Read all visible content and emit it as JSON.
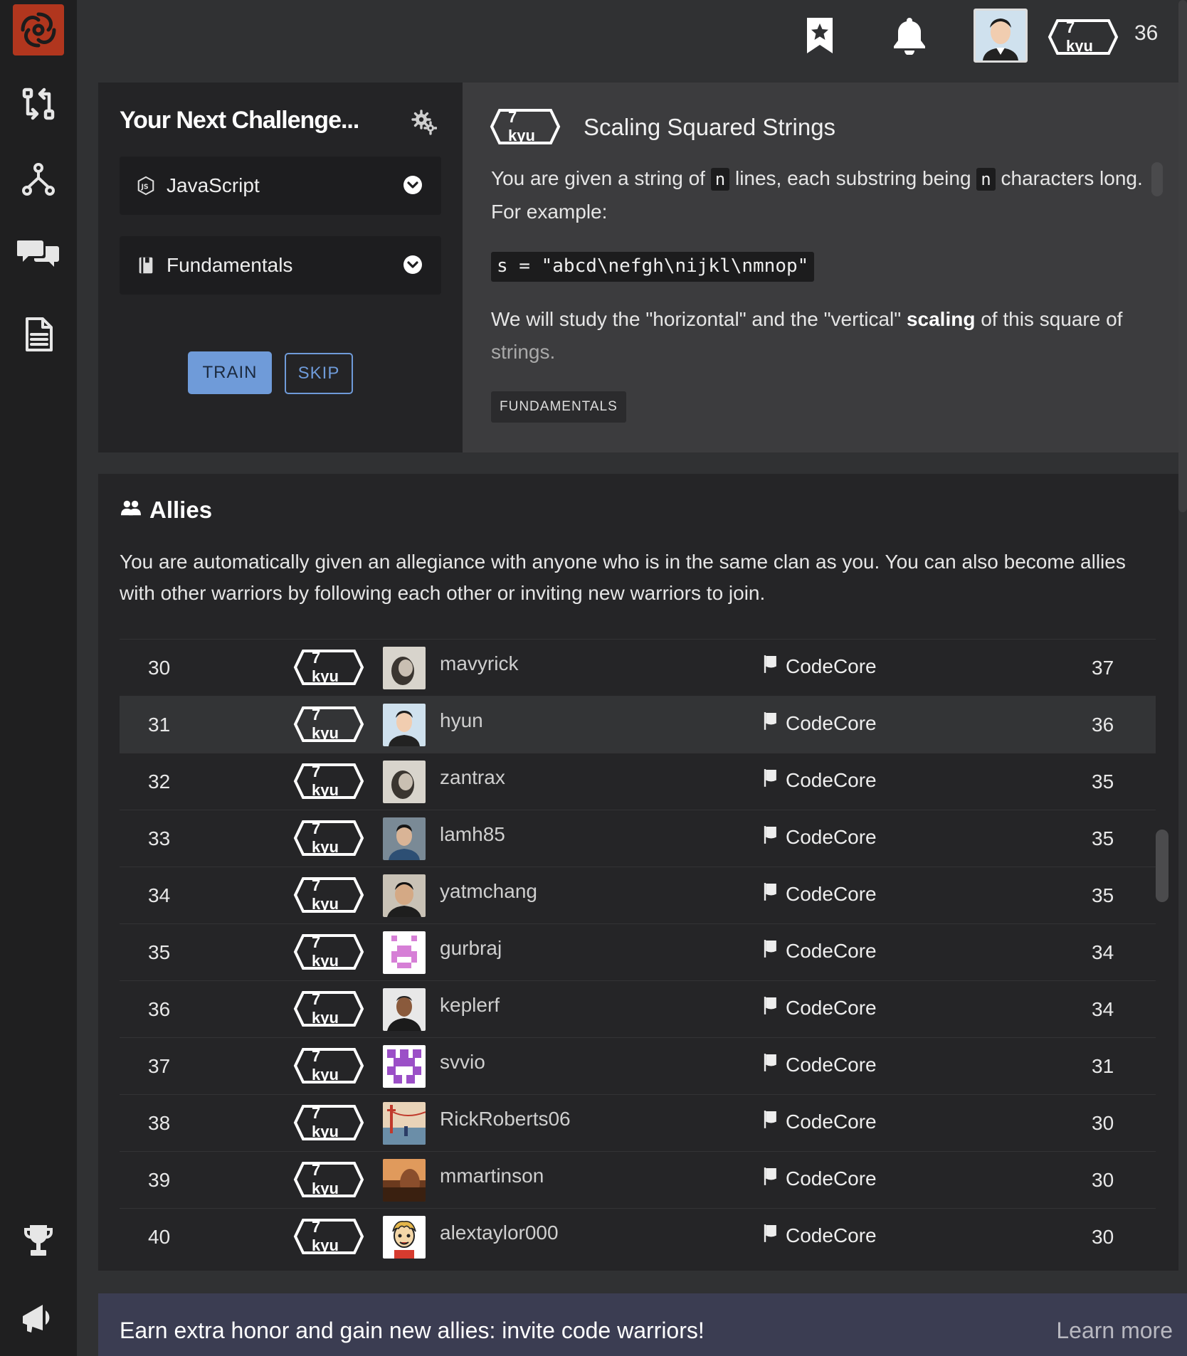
{
  "topbar": {
    "user_rank": "7 kyu",
    "user_honor": "36",
    "icons": [
      "bookmark-star-icon",
      "bell-icon",
      "user-avatar"
    ]
  },
  "sidebar": {
    "items": [
      "practice-icon",
      "kata-tree-icon",
      "discuss-icon",
      "docs-icon",
      "leaderboard-trophy-icon",
      "announce-megaphone-icon"
    ]
  },
  "challenge": {
    "title": "Your Next Challenge...",
    "language": "JavaScript",
    "focus": "Fundamentals",
    "train_label": "TRAIN",
    "skip_label": "SKIP"
  },
  "kata": {
    "rank": "7 kyu",
    "title": "Scaling Squared Strings",
    "desc_p1_a": "You are given a string of ",
    "desc_p1_code1": "n",
    "desc_p1_b": " lines, each substring being ",
    "desc_p1_code2": "n",
    "desc_p1_c": " characters long.",
    "desc_p1_d": "For example:",
    "code": "s = \"abcd\\nefgh\\nijkl\\nmnop\"",
    "desc_p2_a": "We will study the \"horizontal\" and the \"vertical\" ",
    "desc_p2_bold": "scaling",
    "desc_p2_b": " of this square of",
    "desc_p2_c": "strings.",
    "tag": "FUNDAMENTALS"
  },
  "allies": {
    "title": "Allies",
    "description": "You are automatically given an allegiance with anyone who is in the same clan as you. You can also become allies with other warriors by following each other or inviting new warriors to join.",
    "rows": [
      {
        "pos": "30",
        "rank": "7 kyu",
        "name": "mavyrick",
        "clan": "CodeCore",
        "honor": "37"
      },
      {
        "pos": "31",
        "rank": "7 kyu",
        "name": "hyun",
        "clan": "CodeCore",
        "honor": "36"
      },
      {
        "pos": "32",
        "rank": "7 kyu",
        "name": "zantrax",
        "clan": "CodeCore",
        "honor": "35"
      },
      {
        "pos": "33",
        "rank": "7 kyu",
        "name": "lamh85",
        "clan": "CodeCore",
        "honor": "35"
      },
      {
        "pos": "34",
        "rank": "7 kyu",
        "name": "yatmchang",
        "clan": "CodeCore",
        "honor": "35"
      },
      {
        "pos": "35",
        "rank": "7 kyu",
        "name": "gurbraj",
        "clan": "CodeCore",
        "honor": "34"
      },
      {
        "pos": "36",
        "rank": "7 kyu",
        "name": "keplerf",
        "clan": "CodeCore",
        "honor": "34"
      },
      {
        "pos": "37",
        "rank": "7 kyu",
        "name": "svvio",
        "clan": "CodeCore",
        "honor": "31"
      },
      {
        "pos": "38",
        "rank": "7 kyu",
        "name": "RickRoberts06",
        "clan": "CodeCore",
        "honor": "30"
      },
      {
        "pos": "39",
        "rank": "7 kyu",
        "name": "mmartinson",
        "clan": "CodeCore",
        "honor": "30"
      },
      {
        "pos": "40",
        "rank": "7 kyu",
        "name": "alextaylor000",
        "clan": "CodeCore",
        "honor": "30"
      }
    ]
  },
  "banner": {
    "text": "Earn extra honor and gain new allies: invite code warriors!",
    "link": "Learn more"
  },
  "colors": {
    "accent_blue": "#6f9bd9",
    "logo_red": "#b1361e",
    "banner_bg": "#3b3d52"
  }
}
